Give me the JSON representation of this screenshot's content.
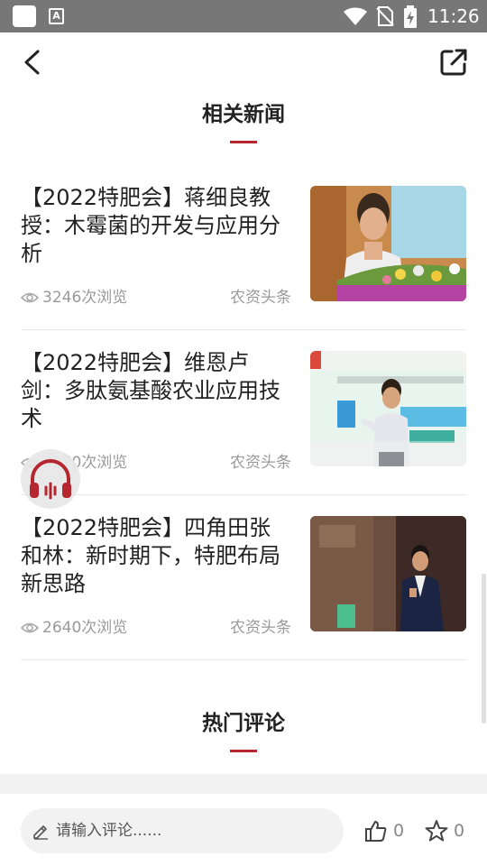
{
  "status_bar": {
    "time": "11:26",
    "a_icon_label": "A",
    "icons": [
      "app-icon",
      "a-notification-icon",
      "wifi-icon",
      "no-sim-icon",
      "battery-charging-icon"
    ]
  },
  "header": {
    "back_icon": "chevron-left-icon",
    "share_icon": "external-share-icon"
  },
  "related_news": {
    "title": "相关新闻",
    "items": [
      {
        "title": "【2022特肥会】蒋细良教授：木霉菌的开发与应用分析",
        "views": "3246次浏览",
        "source": "农资头条"
      },
      {
        "title": "【2022特肥会】维恩卢剑：多肽氨基酸农业应用技术",
        "views": "3270次浏览",
        "source": "农资头条"
      },
      {
        "title": "【2022特肥会】四角田张和林：新时期下，特肥布局新思路",
        "views": "2640次浏览",
        "source": "农资头条"
      }
    ]
  },
  "hot_comments": {
    "title": "热门评论"
  },
  "comment_bar": {
    "placeholder": "请输入评论......",
    "like_count": "0",
    "fav_count": "0"
  },
  "colors": {
    "accent": "#b5262f",
    "status_bar": "#777777",
    "muted_text": "#999999"
  }
}
